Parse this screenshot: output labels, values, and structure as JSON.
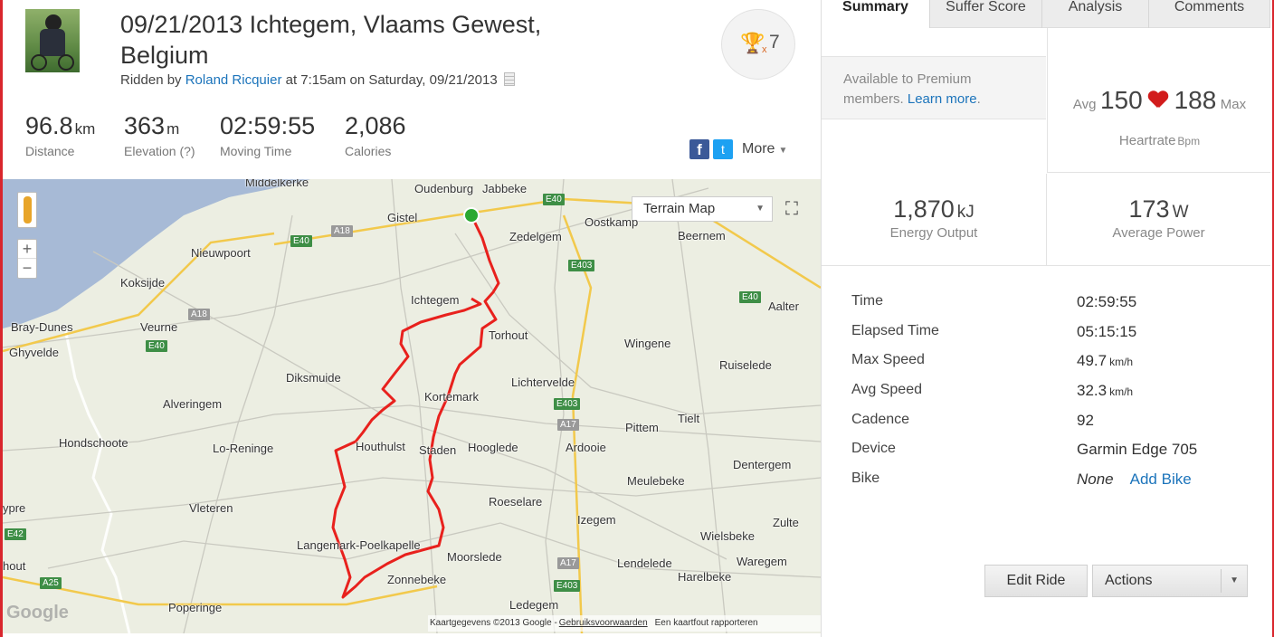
{
  "activity": {
    "title": "09/21/2013 Ichtegem, Vlaams Gewest, Belgium",
    "ridden_by_prefix": "Ridden by",
    "athlete": "Roland Ricquier",
    "when": "at 7:15am on Saturday, 09/21/2013",
    "achievement_x": "x",
    "achievement_count": "7"
  },
  "stats": [
    {
      "value": "96.8",
      "unit": "km",
      "label": "Distance"
    },
    {
      "value": "363",
      "unit": "m",
      "label": "Elevation (?)"
    },
    {
      "value": "02:59:55",
      "unit": "",
      "label": "Moving Time"
    },
    {
      "value": "2,086",
      "unit": "",
      "label": "Calories"
    }
  ],
  "share": {
    "facebook_glyph": "f",
    "twitter_glyph": "t",
    "more_label": "More"
  },
  "map": {
    "type_label": "Terrain Map",
    "google": "Google",
    "attribution": "Kaartgegevens ©2013 Google -",
    "terms": "Gebruiksvoorwaarden",
    "report": "Een kaartfout rapporteren",
    "zoom_in": "+",
    "zoom_out": "−",
    "places": [
      "Middelkerke",
      "Oudenburg",
      "Jabbeke",
      "Gistel",
      "Oostkamp",
      "Zedelgem",
      "Beernem",
      "Nieuwpoort",
      "Koksijde",
      "Ichtegem",
      "Aalter",
      "Bray-Dunes",
      "Veurne",
      "Torhout",
      "Ghyvelde",
      "Wingene",
      "Ruiselede",
      "Diksmuide",
      "Lichtervelde",
      "Alveringem",
      "Kortemark",
      "Tielt",
      "Pittem",
      "Hondschoote",
      "Lo-Reninge",
      "Houthulst",
      "Staden",
      "Hooglede",
      "Ardooie",
      "Dentergem",
      "Meulebeke",
      "Vleteren",
      "Roeselare",
      "ypre",
      "Izegem",
      "Zulte",
      "Langemark-Poelkapelle",
      "Moorslede",
      "Wielsbeke",
      "hout",
      "Waregem",
      "Lendelede",
      "Zonnebeke",
      "Harelbeke",
      "Poperinge",
      "Ledegem"
    ],
    "roads": [
      "E40",
      "A18",
      "E40",
      "A18",
      "E40",
      "E403",
      "E40",
      "E403",
      "A17",
      "E42",
      "A25",
      "A17",
      "E403"
    ]
  },
  "tabs": [
    "Summary",
    "Suffer Score",
    "Analysis",
    "Comments"
  ],
  "premium": {
    "text": "Available to Premium members.",
    "link": "Learn more"
  },
  "heartrate": {
    "avg_label": "Avg",
    "avg": "150",
    "max": "188",
    "max_label": "Max",
    "label": "Heartrate",
    "unit": "Bpm"
  },
  "energy": {
    "value": "1,870",
    "unit": "kJ",
    "label": "Energy Output"
  },
  "power": {
    "value": "173",
    "unit": "W",
    "label": "Average Power"
  },
  "details": [
    {
      "key": "Time",
      "value": "02:59:55",
      "unit": ""
    },
    {
      "key": "Elapsed Time",
      "value": "05:15:15",
      "unit": ""
    },
    {
      "key": "Max Speed",
      "value": "49.7",
      "unit": "km/h"
    },
    {
      "key": "Avg Speed",
      "value": "32.3",
      "unit": "km/h"
    },
    {
      "key": "Cadence",
      "value": "92",
      "unit": ""
    },
    {
      "key": "Device",
      "value": "Garmin Edge 705",
      "unit": ""
    }
  ],
  "bike": {
    "key": "Bike",
    "value": "None",
    "link": "Add Bike"
  },
  "buttons": {
    "edit": "Edit Ride",
    "actions": "Actions"
  },
  "colors": {
    "route": "#e8211d",
    "link": "#1c74bb",
    "frame": "#d9262d",
    "water": "#a7bad6",
    "land": "#eceee2"
  }
}
